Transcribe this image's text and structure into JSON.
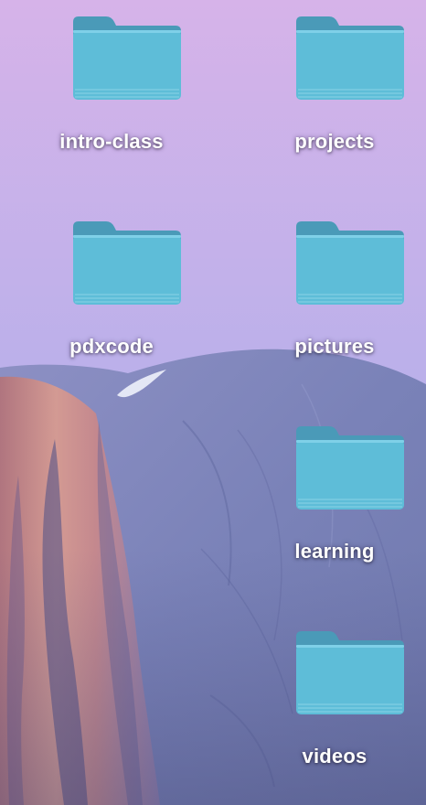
{
  "desktop": {
    "wallpaper": "half-dome-dusk",
    "colors": {
      "sky_top": "#d6b2e8",
      "sky_bottom": "#a9b0ea",
      "rock": "#7f86bc",
      "rock_warm": "#c98a8e",
      "folder_body": "#5cbcd8",
      "folder_tab": "#4a9db8"
    },
    "icons": [
      {
        "label": "intro-class",
        "icon": "folder-icon"
      },
      {
        "label": "projects",
        "icon": "folder-icon"
      },
      {
        "label": "pdxcode",
        "icon": "folder-icon"
      },
      {
        "label": "pictures",
        "icon": "folder-icon"
      },
      {
        "label": "learning",
        "icon": "folder-icon"
      },
      {
        "label": "videos",
        "icon": "folder-icon"
      }
    ]
  }
}
